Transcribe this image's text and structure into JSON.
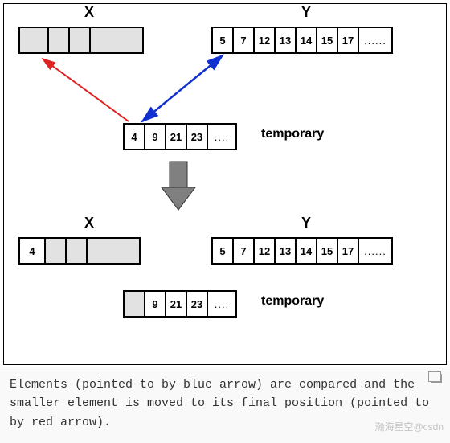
{
  "stage1": {
    "x_label": "X",
    "y_label": "Y",
    "x_cells": [
      "",
      "",
      "",
      ""
    ],
    "y_cells": [
      "5",
      "7",
      "12",
      "13",
      "14",
      "15",
      "17",
      "......"
    ],
    "temp_cells": [
      "4",
      "9",
      "21",
      "23",
      "...."
    ],
    "temp_label": "temporary"
  },
  "stage2": {
    "x_label": "X",
    "y_label": "Y",
    "x_cells": [
      "4",
      "",
      "",
      ""
    ],
    "y_cells": [
      "5",
      "7",
      "12",
      "13",
      "14",
      "15",
      "17",
      "......"
    ],
    "temp_cells": [
      "",
      "9",
      "21",
      "23",
      "...."
    ],
    "temp_label": "temporary"
  },
  "caption": "Elements (pointed to by blue arrow) are compared and the smaller element is moved to its final position (pointed to by red arrow).",
  "watermark": "瀚海星空@csdn",
  "colors": {
    "red": "#d22",
    "blue": "#1030cf",
    "grey_arrow": "#808080"
  },
  "chart_data": {
    "type": "table",
    "description": "Merge-sort merge step illustration (two states before and after moving one element)",
    "states": [
      {
        "X": [
          null,
          null,
          null,
          null
        ],
        "Y": [
          5,
          7,
          12,
          13,
          14,
          15,
          17
        ],
        "temporary": [
          4,
          9,
          21,
          23
        ],
        "blue_arrow_targets": [
          "Y[0]",
          "temporary[0]"
        ],
        "red_arrow_target": "X[0]"
      },
      {
        "X": [
          4,
          null,
          null,
          null
        ],
        "Y": [
          5,
          7,
          12,
          13,
          14,
          15,
          17
        ],
        "temporary": [
          null,
          9,
          21,
          23
        ]
      }
    ]
  }
}
